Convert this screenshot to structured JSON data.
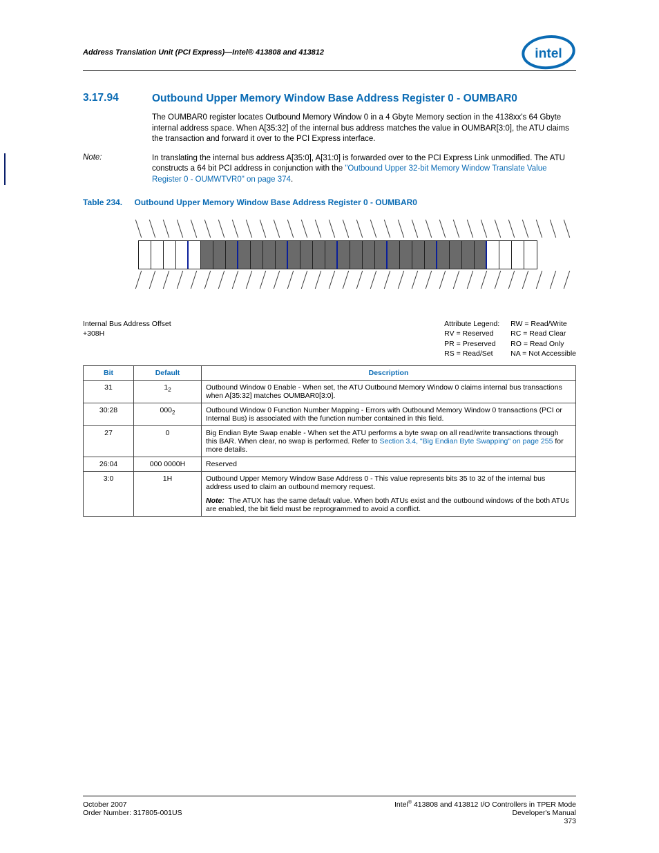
{
  "header": {
    "running": "Address Translation Unit (PCI Express)—Intel® 413808 and 413812"
  },
  "section": {
    "number": "3.17.94",
    "title": "Outbound Upper Memory Window Base Address Register 0 - OUMBAR0"
  },
  "paragraph": "The OUMBAR0 register locates Outbound Memory Window 0 in a 4 Gbyte Memory section in the 4138xx's 64 Gbyte internal address space. When A[35:32] of the internal bus address matches the value in OUMBAR[3:0], the ATU claims the transaction and forward it over to the PCI Express interface.",
  "note": {
    "label": "Note:",
    "text_a": "In translating the internal bus address A[35:0], A[31:0] is forwarded over to the PCI Express Link unmodified. The ATU constructs a 64 bit PCI address in conjunction with the ",
    "xref": "\"Outbound Upper 32-bit Memory Window Translate Value Register 0 - OUMWTVR0\" on page 374",
    "text_b": "."
  },
  "table_caption": {
    "num": "Table 234.",
    "title": "Outbound Upper Memory Window Base Address Register  0 - OUMBAR0"
  },
  "offset": {
    "label": "Internal Bus Address Offset",
    "value": "+308H"
  },
  "legend": {
    "title": "Attribute Legend:",
    "items_a": [
      "RV = Reserved",
      "PR = Preserved",
      "RS = Read/Set"
    ],
    "items_b": [
      "RW = Read/Write",
      "RC = Read Clear",
      "RO = Read Only",
      "NA = Not Accessible"
    ]
  },
  "columns": {
    "bit": "Bit",
    "def": "Default",
    "desc": "Description"
  },
  "rows": [
    {
      "bit": "31",
      "def": "1",
      "def_sub": "2",
      "desc": "Outbound Window 0 Enable - When set, the ATU Outbound Memory Window 0 claims internal bus transactions when A[35:32] matches OUMBAR0[3:0]."
    },
    {
      "bit": "30:28",
      "def": "000",
      "def_sub": "2",
      "desc": "Outbound Window 0 Function Number Mapping - Errors with Outbound Memory Window 0 transactions (PCI or Internal Bus) is associated with the function number contained in this field."
    },
    {
      "bit": "27",
      "def": "0",
      "def_sub": "",
      "desc_a": "Big Endian Byte Swap enable - When set the ATU performs a byte swap on all read/write transactions through this BAR. When clear, no swap is performed. Refer to ",
      "xref": "Section 3.4, \"Big Endian Byte Swapping\" on page 255",
      "desc_b": " for more details."
    },
    {
      "bit": "26:04",
      "def": "000 0000H",
      "def_sub": "",
      "desc": "Reserved"
    },
    {
      "bit": "3:0",
      "def": "1H",
      "def_sub": "",
      "desc": "Outbound Upper Memory Window Base Address 0 - This value represents bits 35 to 32 of the internal bus address used to claim an outbound memory request.",
      "note_label": "Note:",
      "note": "The ATUX has the same default value. When both ATUs exist and the outbound windows of the both ATUs are enabled, the bit field must be reprogrammed to avoid a conflict."
    }
  ],
  "footer": {
    "left_a": "October 2007",
    "left_b": "Order Number: 317805-001US",
    "right_a": "Intel® 413808 and 413812 I/O Controllers in TPER Mode",
    "right_b": "Developer's Manual",
    "right_c": "373"
  }
}
